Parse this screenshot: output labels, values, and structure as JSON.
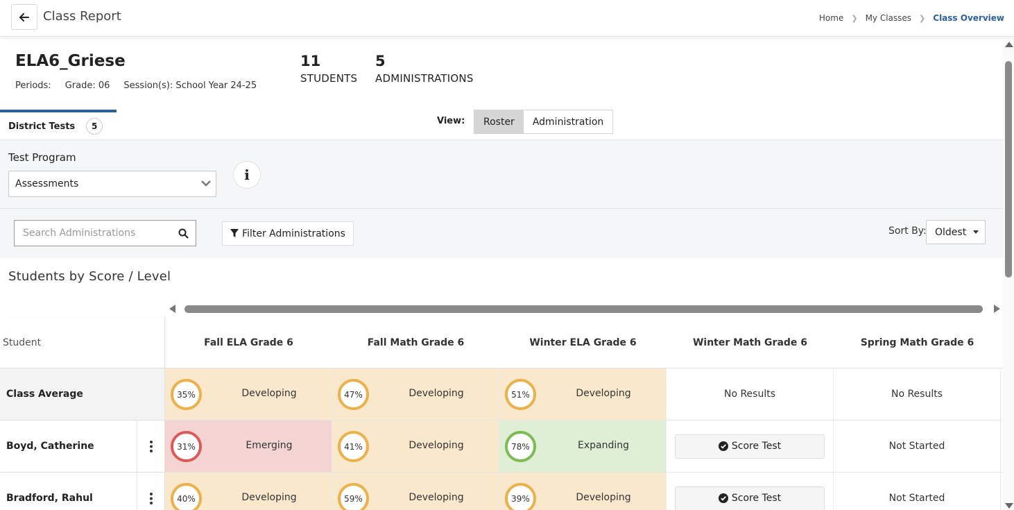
{
  "header": {
    "title": "Class Report",
    "breadcrumb": [
      "Home",
      "My Classes",
      "Class Overview"
    ]
  },
  "class": {
    "name": "ELA6_Griese",
    "periods_label": "Periods:",
    "grade": "Grade: 06",
    "sessions": "Session(s): School Year 24-25",
    "students_count": "11",
    "students_label": "STUDENTS",
    "administrations_count": "5",
    "administrations_label": "ADMINISTRATIONS"
  },
  "tabs": {
    "district_tests_label": "District Tests",
    "district_tests_count": "5"
  },
  "view": {
    "label": "View:",
    "options": [
      "Roster",
      "Administration"
    ],
    "selected": "Roster"
  },
  "filters": {
    "test_program_label": "Test Program",
    "test_program_value": "Assessments",
    "search_placeholder": "Search Administrations",
    "filter_button_label": "Filter Administrations",
    "sort_by_label": "Sort By:",
    "sort_by_value": "Oldest"
  },
  "section_title": "Students by Score / Level",
  "table": {
    "student_header": "Student",
    "columns": [
      "Fall ELA Grade 6",
      "Fall Math Grade 6",
      "Winter ELA Grade 6",
      "Winter Math Grade 6",
      "Spring Math Grade 6"
    ],
    "rows": [
      {
        "name": "Class Average",
        "cells": [
          {
            "pct": "35%",
            "level": "Developing"
          },
          {
            "pct": "47%",
            "level": "Developing"
          },
          {
            "pct": "51%",
            "level": "Developing"
          },
          {
            "text": "No Results"
          },
          {
            "text": "No Results"
          }
        ]
      },
      {
        "name": "Boyd, Catherine",
        "cells": [
          {
            "pct": "31%",
            "level": "Emerging"
          },
          {
            "pct": "41%",
            "level": "Developing"
          },
          {
            "pct": "78%",
            "level": "Expanding"
          },
          {
            "button": "Score Test"
          },
          {
            "text": "Not Started"
          }
        ]
      },
      {
        "name": "Bradford, Rahul",
        "cells": [
          {
            "pct": "40%",
            "level": "Developing"
          },
          {
            "pct": "59%",
            "level": "Developing"
          },
          {
            "pct": "39%",
            "level": "Developing"
          },
          {
            "button": "Score Test"
          },
          {
            "text": "Not Started"
          }
        ]
      }
    ]
  },
  "colors": {
    "accent": "#2b5f9e",
    "developing_bg": "#fae8cd",
    "developing_ring": "#eab14c",
    "emerging_bg": "#f4d3d3",
    "emerging_ring": "#db5b5b",
    "expanding_bg": "#deefd5",
    "expanding_ring": "#7ebb55"
  },
  "icons": [
    "arrow-left-icon",
    "chevron-right-icon",
    "chevron-down-icon",
    "info-icon",
    "search-icon",
    "filter-icon",
    "caret-down-icon",
    "kebab-icon",
    "check-circle-icon"
  ]
}
